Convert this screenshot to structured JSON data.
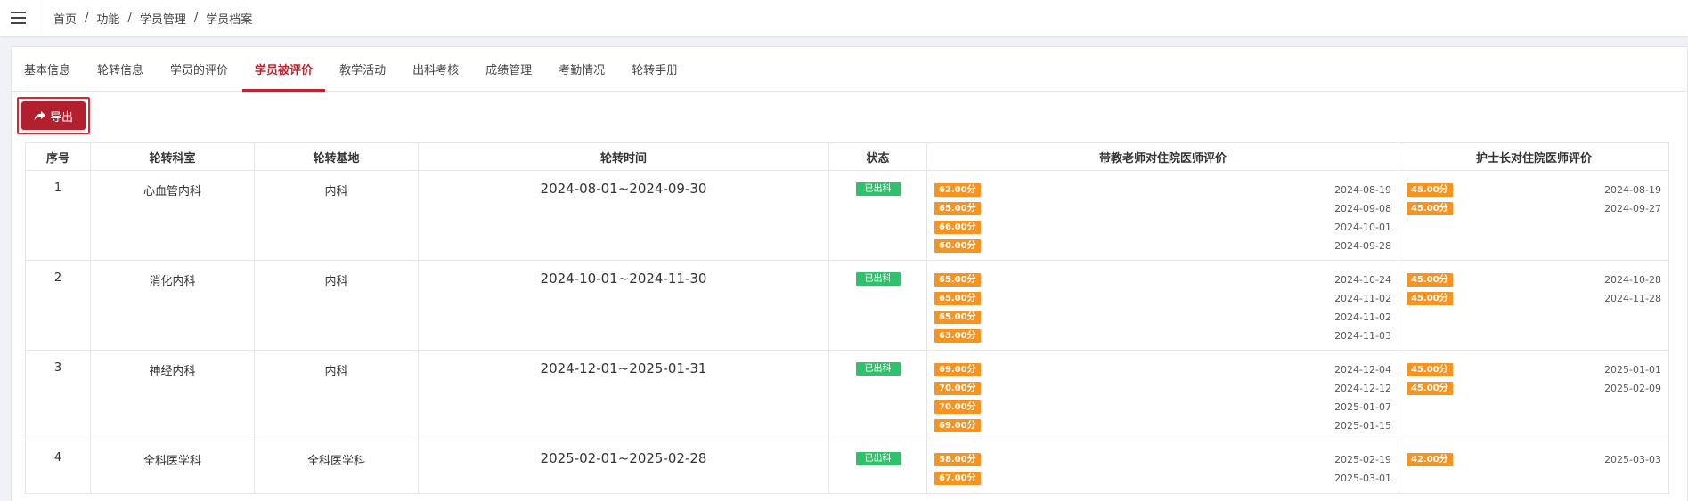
{
  "breadcrumb": [
    "首页",
    "功能",
    "学员管理",
    "学员档案"
  ],
  "tabs": [
    "基本信息",
    "轮转信息",
    "学员的评价",
    "学员被评价",
    "教学活动",
    "出科考核",
    "成绩管理",
    "考勤情况",
    "轮转手册"
  ],
  "active_tab": "学员被评价",
  "toolbar": {
    "export_label": "导出"
  },
  "table": {
    "headers": [
      "序号",
      "轮转科室",
      "轮转基地",
      "轮转时间",
      "状态",
      "带教老师对住院医师评价",
      "护士长对住院医师评价"
    ],
    "rows": [
      {
        "index": "1",
        "dept": "心血管内科",
        "base": "内科",
        "period": "2024-08-01~2024-09-30",
        "status": "已出科",
        "teacher_evals": [
          {
            "score": "62.00分",
            "date": "2024-08-19"
          },
          {
            "score": "65.00分",
            "date": "2024-09-08"
          },
          {
            "score": "66.00分",
            "date": "2024-10-01"
          },
          {
            "score": "60.00分",
            "date": "2024-09-28"
          }
        ],
        "nurse_evals": [
          {
            "score": "45.00分",
            "date": "2024-08-19"
          },
          {
            "score": "45.00分",
            "date": "2024-09-27"
          }
        ]
      },
      {
        "index": "2",
        "dept": "消化内科",
        "base": "内科",
        "period": "2024-10-01~2024-11-30",
        "status": "已出科",
        "teacher_evals": [
          {
            "score": "65.00分",
            "date": "2024-10-24"
          },
          {
            "score": "65.00分",
            "date": "2024-11-02"
          },
          {
            "score": "65.00分",
            "date": "2024-11-02"
          },
          {
            "score": "63.00分",
            "date": "2024-11-03"
          }
        ],
        "nurse_evals": [
          {
            "score": "45.00分",
            "date": "2024-10-28"
          },
          {
            "score": "45.00分",
            "date": "2024-11-28"
          }
        ]
      },
      {
        "index": "3",
        "dept": "神经内科",
        "base": "内科",
        "period": "2024-12-01~2025-01-31",
        "status": "已出科",
        "teacher_evals": [
          {
            "score": "69.00分",
            "date": "2024-12-04"
          },
          {
            "score": "70.00分",
            "date": "2024-12-12"
          },
          {
            "score": "70.00分",
            "date": "2025-01-07"
          },
          {
            "score": "69.00分",
            "date": "2025-01-15"
          }
        ],
        "nurse_evals": [
          {
            "score": "45.00分",
            "date": "2025-01-01"
          },
          {
            "score": "45.00分",
            "date": "2025-02-09"
          }
        ]
      },
      {
        "index": "4",
        "dept": "全科医学科",
        "base": "全科医学科",
        "period": "2025-02-01~2025-02-28",
        "status": "已出科",
        "teacher_evals": [
          {
            "score": "58.00分",
            "date": "2025-02-19"
          },
          {
            "score": "67.00分",
            "date": "2025-03-01"
          }
        ],
        "nurse_evals": [
          {
            "score": "42.00分",
            "date": "2025-03-03"
          }
        ]
      }
    ]
  },
  "colors": {
    "accent": "#c0232e",
    "export_button": "#b21f2d",
    "status_badge": "#2fc16c",
    "score_badge": "#f7931e"
  },
  "icons": {
    "menu": "hamburger-menu-icon",
    "export": "share-arrow-icon"
  }
}
